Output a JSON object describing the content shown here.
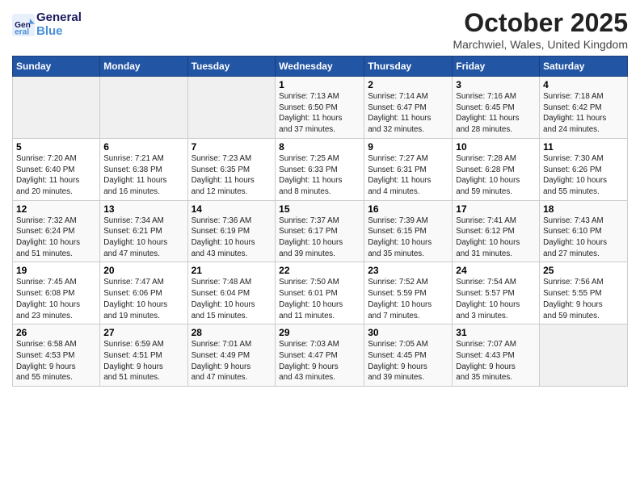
{
  "header": {
    "logo_line1": "General",
    "logo_line2": "Blue",
    "month_title": "October 2025",
    "location": "Marchwiel, Wales, United Kingdom"
  },
  "weekdays": [
    "Sunday",
    "Monday",
    "Tuesday",
    "Wednesday",
    "Thursday",
    "Friday",
    "Saturday"
  ],
  "weeks": [
    [
      {
        "day": "",
        "info": ""
      },
      {
        "day": "",
        "info": ""
      },
      {
        "day": "",
        "info": ""
      },
      {
        "day": "1",
        "info": "Sunrise: 7:13 AM\nSunset: 6:50 PM\nDaylight: 11 hours\nand 37 minutes."
      },
      {
        "day": "2",
        "info": "Sunrise: 7:14 AM\nSunset: 6:47 PM\nDaylight: 11 hours\nand 32 minutes."
      },
      {
        "day": "3",
        "info": "Sunrise: 7:16 AM\nSunset: 6:45 PM\nDaylight: 11 hours\nand 28 minutes."
      },
      {
        "day": "4",
        "info": "Sunrise: 7:18 AM\nSunset: 6:42 PM\nDaylight: 11 hours\nand 24 minutes."
      }
    ],
    [
      {
        "day": "5",
        "info": "Sunrise: 7:20 AM\nSunset: 6:40 PM\nDaylight: 11 hours\nand 20 minutes."
      },
      {
        "day": "6",
        "info": "Sunrise: 7:21 AM\nSunset: 6:38 PM\nDaylight: 11 hours\nand 16 minutes."
      },
      {
        "day": "7",
        "info": "Sunrise: 7:23 AM\nSunset: 6:35 PM\nDaylight: 11 hours\nand 12 minutes."
      },
      {
        "day": "8",
        "info": "Sunrise: 7:25 AM\nSunset: 6:33 PM\nDaylight: 11 hours\nand 8 minutes."
      },
      {
        "day": "9",
        "info": "Sunrise: 7:27 AM\nSunset: 6:31 PM\nDaylight: 11 hours\nand 4 minutes."
      },
      {
        "day": "10",
        "info": "Sunrise: 7:28 AM\nSunset: 6:28 PM\nDaylight: 10 hours\nand 59 minutes."
      },
      {
        "day": "11",
        "info": "Sunrise: 7:30 AM\nSunset: 6:26 PM\nDaylight: 10 hours\nand 55 minutes."
      }
    ],
    [
      {
        "day": "12",
        "info": "Sunrise: 7:32 AM\nSunset: 6:24 PM\nDaylight: 10 hours\nand 51 minutes."
      },
      {
        "day": "13",
        "info": "Sunrise: 7:34 AM\nSunset: 6:21 PM\nDaylight: 10 hours\nand 47 minutes."
      },
      {
        "day": "14",
        "info": "Sunrise: 7:36 AM\nSunset: 6:19 PM\nDaylight: 10 hours\nand 43 minutes."
      },
      {
        "day": "15",
        "info": "Sunrise: 7:37 AM\nSunset: 6:17 PM\nDaylight: 10 hours\nand 39 minutes."
      },
      {
        "day": "16",
        "info": "Sunrise: 7:39 AM\nSunset: 6:15 PM\nDaylight: 10 hours\nand 35 minutes."
      },
      {
        "day": "17",
        "info": "Sunrise: 7:41 AM\nSunset: 6:12 PM\nDaylight: 10 hours\nand 31 minutes."
      },
      {
        "day": "18",
        "info": "Sunrise: 7:43 AM\nSunset: 6:10 PM\nDaylight: 10 hours\nand 27 minutes."
      }
    ],
    [
      {
        "day": "19",
        "info": "Sunrise: 7:45 AM\nSunset: 6:08 PM\nDaylight: 10 hours\nand 23 minutes."
      },
      {
        "day": "20",
        "info": "Sunrise: 7:47 AM\nSunset: 6:06 PM\nDaylight: 10 hours\nand 19 minutes."
      },
      {
        "day": "21",
        "info": "Sunrise: 7:48 AM\nSunset: 6:04 PM\nDaylight: 10 hours\nand 15 minutes."
      },
      {
        "day": "22",
        "info": "Sunrise: 7:50 AM\nSunset: 6:01 PM\nDaylight: 10 hours\nand 11 minutes."
      },
      {
        "day": "23",
        "info": "Sunrise: 7:52 AM\nSunset: 5:59 PM\nDaylight: 10 hours\nand 7 minutes."
      },
      {
        "day": "24",
        "info": "Sunrise: 7:54 AM\nSunset: 5:57 PM\nDaylight: 10 hours\nand 3 minutes."
      },
      {
        "day": "25",
        "info": "Sunrise: 7:56 AM\nSunset: 5:55 PM\nDaylight: 9 hours\nand 59 minutes."
      }
    ],
    [
      {
        "day": "26",
        "info": "Sunrise: 6:58 AM\nSunset: 4:53 PM\nDaylight: 9 hours\nand 55 minutes."
      },
      {
        "day": "27",
        "info": "Sunrise: 6:59 AM\nSunset: 4:51 PM\nDaylight: 9 hours\nand 51 minutes."
      },
      {
        "day": "28",
        "info": "Sunrise: 7:01 AM\nSunset: 4:49 PM\nDaylight: 9 hours\nand 47 minutes."
      },
      {
        "day": "29",
        "info": "Sunrise: 7:03 AM\nSunset: 4:47 PM\nDaylight: 9 hours\nand 43 minutes."
      },
      {
        "day": "30",
        "info": "Sunrise: 7:05 AM\nSunset: 4:45 PM\nDaylight: 9 hours\nand 39 minutes."
      },
      {
        "day": "31",
        "info": "Sunrise: 7:07 AM\nSunset: 4:43 PM\nDaylight: 9 hours\nand 35 minutes."
      },
      {
        "day": "",
        "info": ""
      }
    ]
  ]
}
